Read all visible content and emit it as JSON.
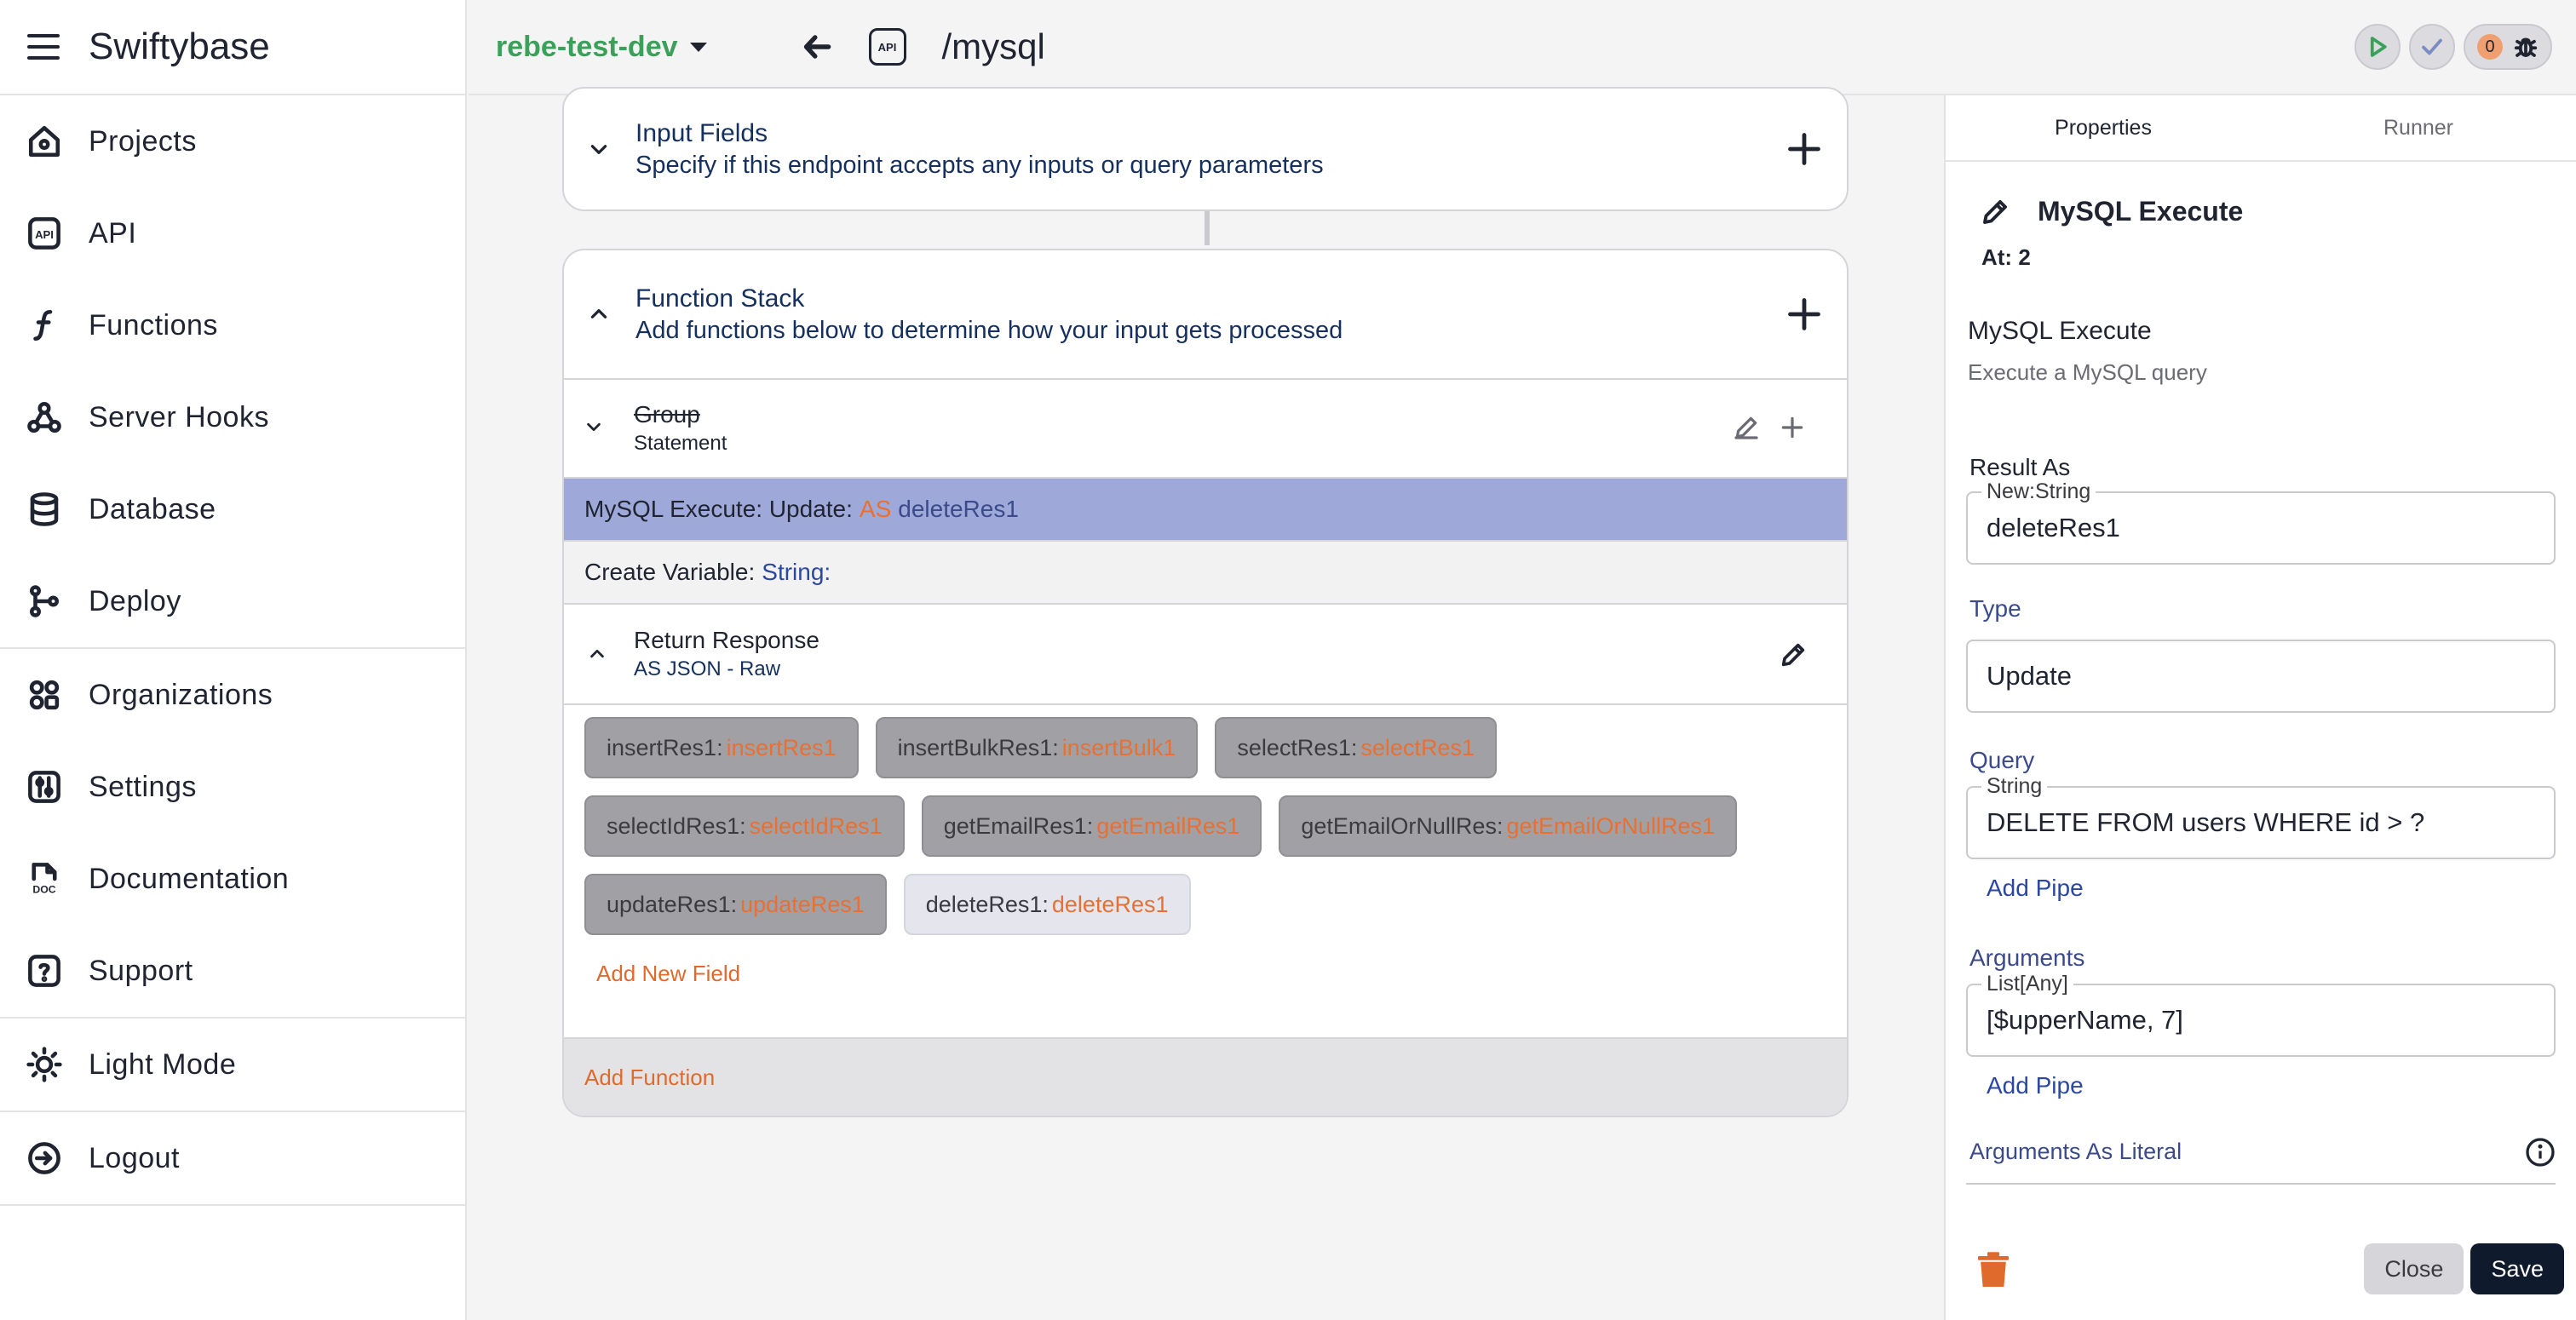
{
  "brand": {
    "title": "Swiftybase"
  },
  "sidebar": {
    "items": [
      {
        "label": "Projects",
        "icon": "home-icon"
      },
      {
        "label": "API",
        "icon": "api-icon"
      },
      {
        "label": "Functions",
        "icon": "function-icon"
      },
      {
        "label": "Server Hooks",
        "icon": "webhook-icon"
      },
      {
        "label": "Database",
        "icon": "database-icon"
      },
      {
        "label": "Deploy",
        "icon": "git-branch-icon"
      },
      {
        "label": "Organizations",
        "icon": "organization-icon"
      },
      {
        "label": "Settings",
        "icon": "settings-icon"
      },
      {
        "label": "Documentation",
        "icon": "doc-icon"
      },
      {
        "label": "Support",
        "icon": "help-icon"
      },
      {
        "label": "Light Mode",
        "icon": "sun-icon"
      },
      {
        "label": "Logout",
        "icon": "logout-icon"
      }
    ],
    "api_icon_text": "API",
    "doc_icon_text": "DOC"
  },
  "topbar": {
    "project": "rebe-test-dev",
    "api_badge": "API",
    "path": "/mysql",
    "debug_count": "0"
  },
  "canvas": {
    "input_fields": {
      "title": "Input Fields",
      "subtitle": "Specify if this endpoint accepts any inputs or query parameters"
    },
    "function_stack": {
      "title": "Function Stack",
      "subtitle": "Add functions below to determine how your input gets processed"
    },
    "group": {
      "title": "Group",
      "subtitle": "Statement"
    },
    "steps": {
      "mysql": {
        "prefix": "MySQL Execute: Update:",
        "kw": "AS",
        "var": "deleteRes1"
      },
      "create": {
        "prefix": "Create Variable:",
        "type": "String:"
      }
    },
    "return_response": {
      "title": "Return Response",
      "subtitle": "AS JSON - Raw"
    },
    "chips": [
      {
        "key": "insertRes1",
        "value": "insertRes1"
      },
      {
        "key": "insertBulkRes1",
        "value": "insertBulk1"
      },
      {
        "key": "selectRes1",
        "value": "selectRes1"
      },
      {
        "key": "selectIdRes1",
        "value": "selectIdRes1"
      },
      {
        "key": "getEmailRes1",
        "value": "getEmailRes1"
      },
      {
        "key": "getEmailOrNullRes",
        "value": "getEmailOrNullRes1"
      },
      {
        "key": "updateRes1",
        "value": "updateRes1"
      },
      {
        "key": "deleteRes1",
        "value": "deleteRes1"
      }
    ],
    "chip_separator": ":",
    "add_new_field": "Add New Field",
    "add_function": "Add Function"
  },
  "panel": {
    "tabs": [
      "Properties",
      "Runner"
    ],
    "header_name": "MySQL Execute",
    "at": "At: 2",
    "desc_title": "MySQL Execute",
    "desc": "Execute a MySQL query",
    "result_as": {
      "label": "Result As",
      "legend": "New:String",
      "value": "deleteRes1"
    },
    "type": {
      "label": "Type",
      "value": "Update"
    },
    "query": {
      "label": "Query",
      "legend": "String",
      "value": "DELETE FROM users WHERE id > ?"
    },
    "arguments": {
      "label": "Arguments",
      "legend": "List[Any]",
      "value": "[$upperName, 7]"
    },
    "add_pipe": "Add Pipe",
    "arguments_literal": "Arguments As Literal",
    "close": "Close",
    "save": "Save"
  },
  "colors": {
    "project_green": "#3ba15a",
    "accent_orange": "#e87033",
    "selected_step": "#9ea9d9",
    "save_button": "#0f1b2d"
  }
}
